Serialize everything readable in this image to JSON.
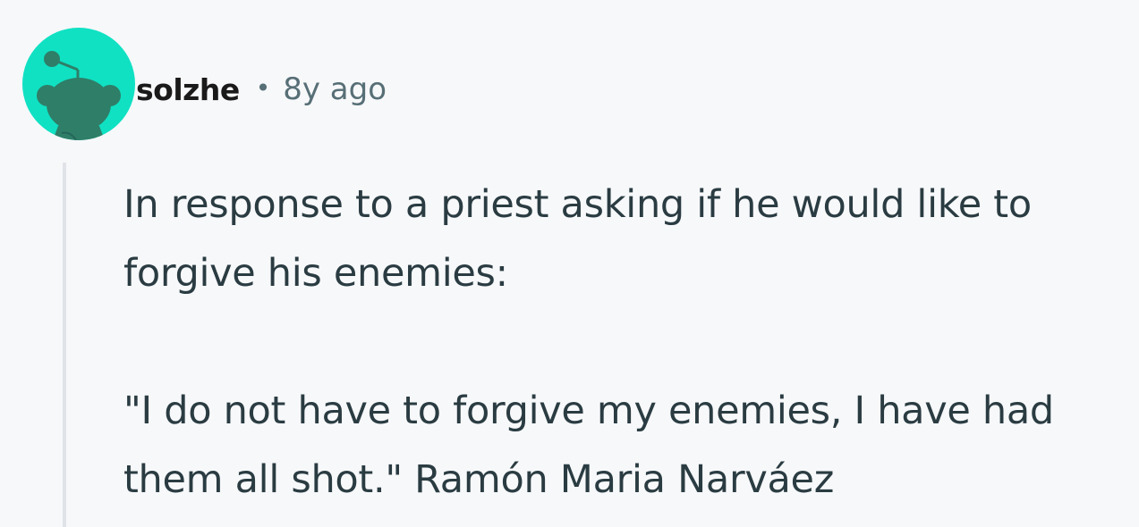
{
  "comment": {
    "author": "solzhe",
    "separator": "•",
    "age": "8y ago",
    "paragraphs": [
      "In response to a priest asking if he would like to forgive his enemies:",
      "\"I do not have to forgive my enemies, I have had them all shot.\" Ramón Maria Narváez"
    ]
  },
  "colors": {
    "avatar_background": "#10e1c3",
    "avatar_figure": "#2f7e68",
    "page_background": "#f7f8fa",
    "thread_line": "#e0e3e8",
    "body_text": "#2a3c42",
    "meta_text": "#576f76"
  },
  "icons": {
    "avatar": "snoo-avatar-icon"
  }
}
